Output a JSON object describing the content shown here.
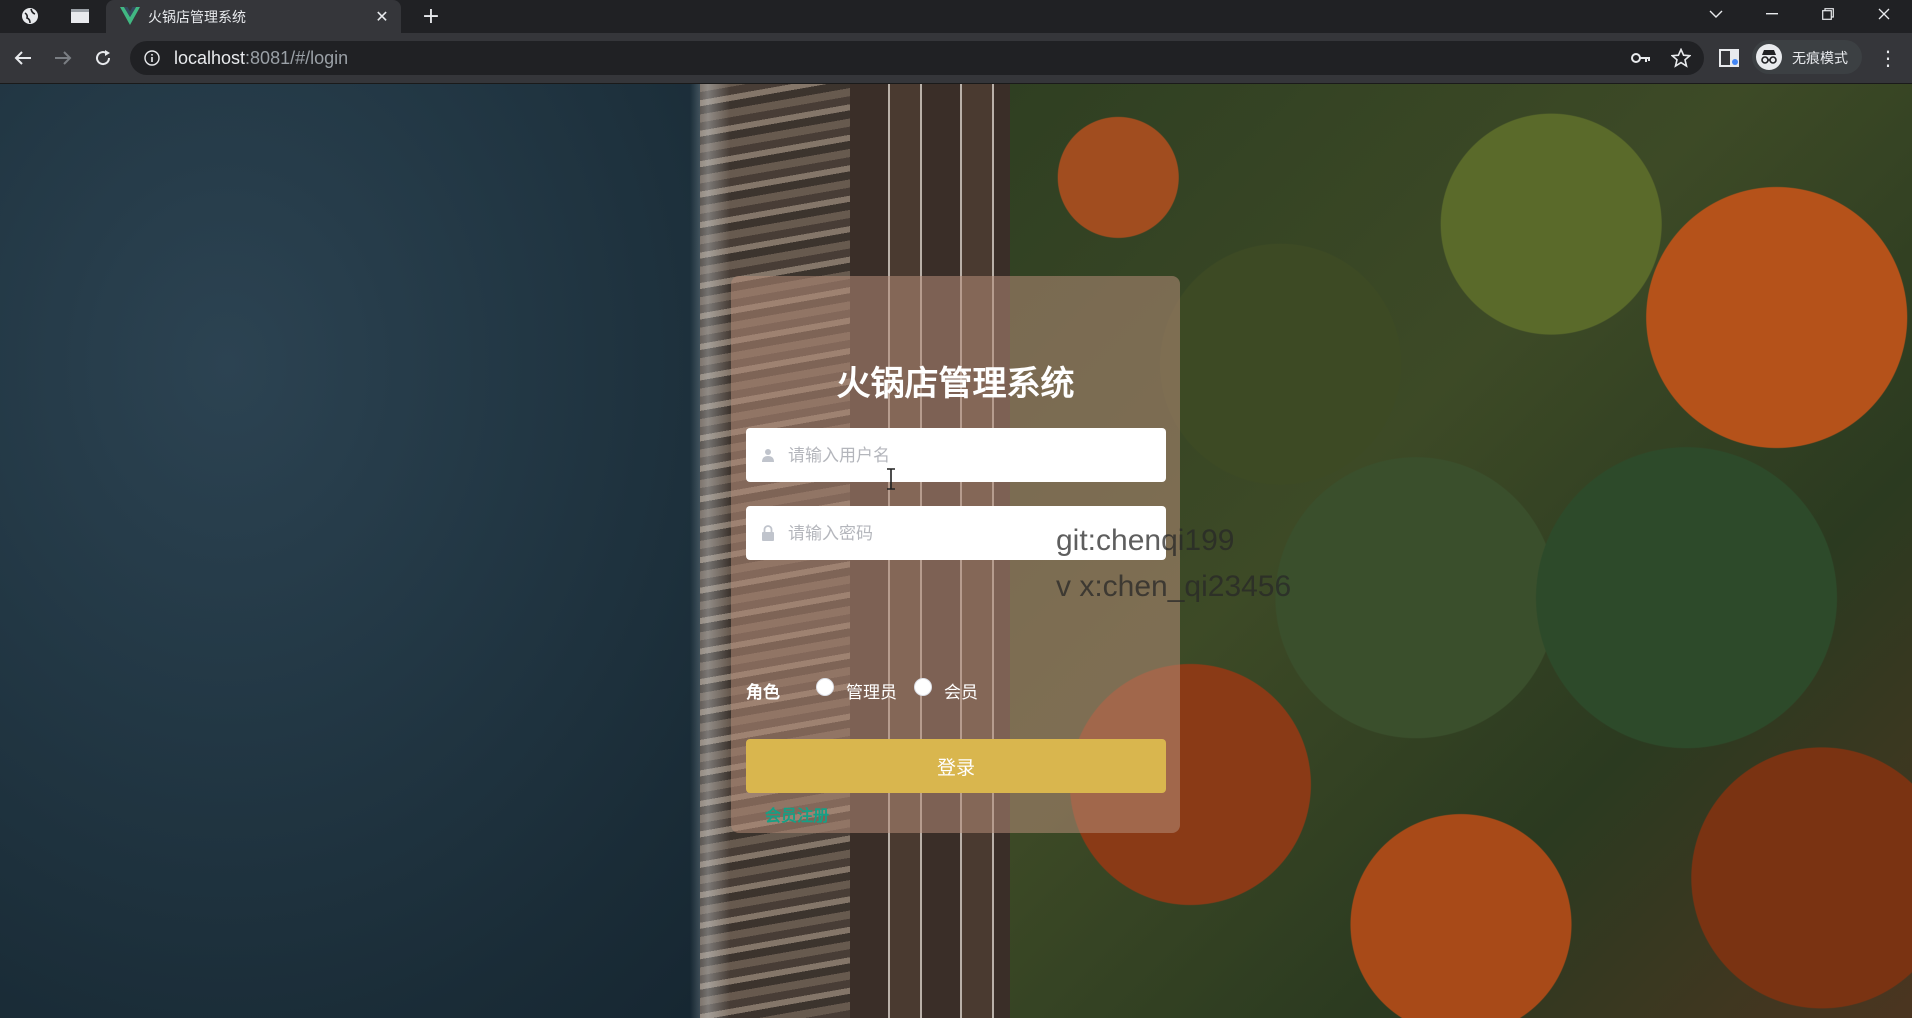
{
  "browser": {
    "tab_title": "火锅店管理系统",
    "url_host": "localhost",
    "url_rest": ":8081/#/login",
    "incognito_label": "无痕模式"
  },
  "login": {
    "title": "火锅店管理系统",
    "username_placeholder": "请输入用户名",
    "password_placeholder": "请输入密码",
    "role_label": "角色",
    "roles": [
      "管理员",
      "会员"
    ],
    "login_button": "登录",
    "register_link": "会员注册"
  },
  "watermark": {
    "line1": "git:chenqi199",
    "line2": "v x:chen_qi23456"
  },
  "colors": {
    "accent_button": "#d9b64e",
    "register_link": "#16a085"
  },
  "icons": [
    "globe-icon",
    "window-icon",
    "vue-icon",
    "close-icon",
    "plus-icon",
    "back-icon",
    "forward-icon",
    "reload-icon",
    "info-icon",
    "key-icon",
    "star-icon",
    "sidepanel-icon",
    "incognito-icon",
    "menu-icon",
    "user-icon",
    "lock-icon"
  ]
}
